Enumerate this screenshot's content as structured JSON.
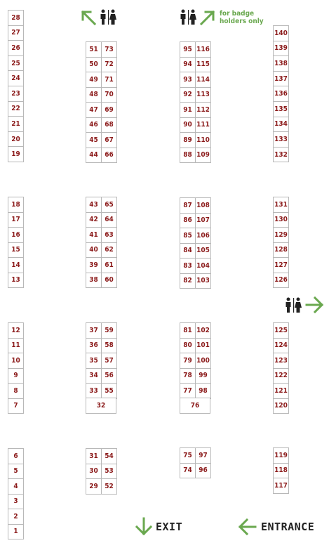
{
  "map": {
    "colors": {
      "booth_number": "#8b1a1a",
      "booth_border": "#b8b8b8",
      "arrow": "#6aa84f",
      "restroom_icon": "#222222",
      "sign_text": "#222222",
      "note_text": "#6aa84f"
    },
    "labels": {
      "exit": "EXIT",
      "entrance": "ENTRANCE",
      "badge_note_line1": "for badge",
      "badge_note_line2": "holders only"
    },
    "icons": {
      "arrow_top_left": "arrow-up-left",
      "arrow_top_right": "arrow-up-right",
      "arrow_right": "arrow-right",
      "arrow_exit": "arrow-down",
      "arrow_entrance": "arrow-left",
      "restroom": "restroom-man-woman"
    },
    "booths": {
      "b_col1_top": [
        "28",
        "27",
        "26",
        "25",
        "24",
        "23",
        "22",
        "21",
        "20",
        "19"
      ],
      "b_col1_mid": [
        "18",
        "17",
        "16",
        "15",
        "14",
        "13"
      ],
      "b_col1_low": [
        "12",
        "11",
        "10",
        "9",
        "8",
        "7"
      ],
      "b_col1_bot": [
        "6",
        "5",
        "4",
        "3",
        "2",
        "1"
      ],
      "b_col2a_top": [
        "51",
        "50",
        "49",
        "48",
        "47",
        "46",
        "45",
        "44"
      ],
      "b_col2b_top": [
        "73",
        "72",
        "71",
        "70",
        "69",
        "68",
        "67",
        "66"
      ],
      "b_col2a_mid": [
        "43",
        "42",
        "41",
        "40",
        "39",
        "38"
      ],
      "b_col2b_mid": [
        "65",
        "64",
        "63",
        "62",
        "61",
        "60"
      ],
      "b_col2a_low": [
        "37",
        "36",
        "35",
        "34",
        "33"
      ],
      "b_col2b_low": [
        "59",
        "58",
        "57",
        "56",
        "55"
      ],
      "b_col2_low_wide": "32",
      "b_col2a_bot": [
        "31",
        "30",
        "29"
      ],
      "b_col2b_bot": [
        "54",
        "53",
        "52"
      ],
      "b_col3a_top": [
        "95",
        "94",
        "93",
        "92",
        "91",
        "90",
        "89",
        "88"
      ],
      "b_col3b_top": [
        "116",
        "115",
        "114",
        "113",
        "112",
        "111",
        "110",
        "109"
      ],
      "b_col3a_mid": [
        "87",
        "86",
        "85",
        "84",
        "83",
        "82"
      ],
      "b_col3b_mid": [
        "108",
        "107",
        "106",
        "105",
        "104",
        "103"
      ],
      "b_col3a_low": [
        "81",
        "80",
        "79",
        "78",
        "77"
      ],
      "b_col3b_low": [
        "102",
        "101",
        "100",
        "99",
        "98"
      ],
      "b_col3_low_wide": "76",
      "b_col3a_bot": [
        "75",
        "74"
      ],
      "b_col3b_bot": [
        "97",
        "96"
      ],
      "b_col4_top": [
        "140",
        "139",
        "138",
        "137",
        "136",
        "135",
        "134",
        "133",
        "132"
      ],
      "b_col4_mid": [
        "131",
        "130",
        "129",
        "128",
        "127",
        "126"
      ],
      "b_col4_low": [
        "125",
        "124",
        "123",
        "122",
        "121",
        "120"
      ],
      "b_col4_bot": [
        "119",
        "118",
        "117"
      ]
    }
  }
}
